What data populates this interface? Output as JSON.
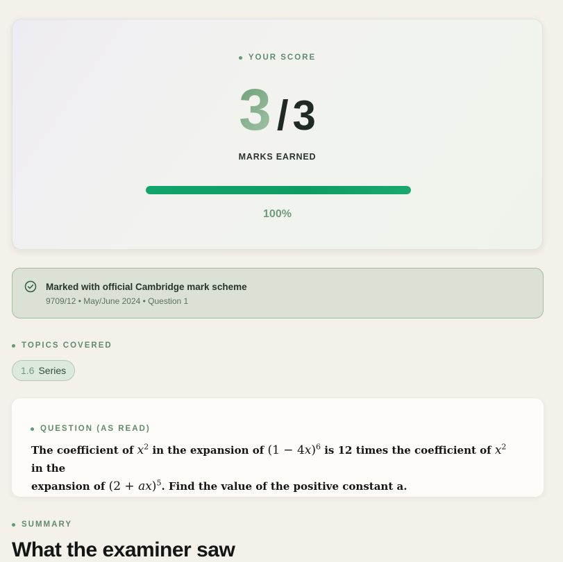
{
  "score_card": {
    "eyebrow": "YOUR SCORE",
    "score": "3",
    "separator": "/",
    "total": "3",
    "marks_label": "MARKS EARNED",
    "progress_fraction": 1.0,
    "percent_label": "100%",
    "progress_color": "#12a46c"
  },
  "banner": {
    "title": "Marked with official Cambridge mark scheme",
    "subtitle": "9709/12 • May/June 2024 • Question 1",
    "icon": "check-circle-icon"
  },
  "topics": {
    "eyebrow": "TOPICS COVERED",
    "items": [
      {
        "code": "1.6",
        "label": "Series"
      }
    ]
  },
  "question": {
    "eyebrow": "QUESTION (AS READ)",
    "line1_a": "The coefficient of ",
    "line1_b": " in the expansion of ",
    "line1_c": " is 12 times the coefficient of ",
    "line1_d": " in the",
    "line2_a": "expansion of ",
    "line2_b": ". Find the value of the positive constant a."
  },
  "summary": {
    "eyebrow": "SUMMARY",
    "heading": "What the examiner saw"
  },
  "colors": {
    "page_background": "#f4f0ea",
    "accent_green": "#5e8c6c",
    "banner_background": "#dbe2d5"
  }
}
